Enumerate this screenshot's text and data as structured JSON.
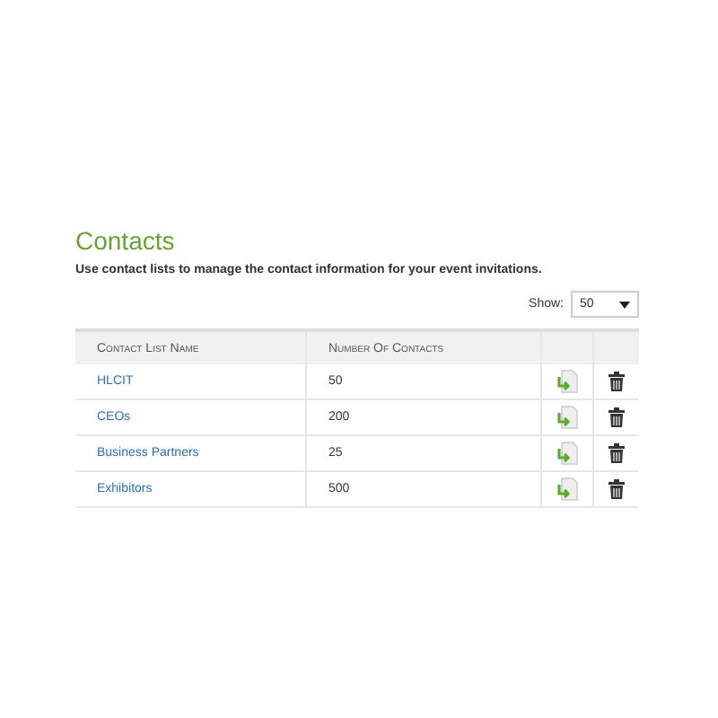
{
  "title": "Contacts",
  "description": "Use contact lists to manage the contact information for your event invitations.",
  "show": {
    "label": "Show:",
    "value": "50"
  },
  "table": {
    "columns": [
      "Contact List Name",
      "Number Of Contacts"
    ],
    "rows": [
      {
        "name": "HLCIT",
        "count": "50"
      },
      {
        "name": "CEOs",
        "count": "200"
      },
      {
        "name": "Business Partners",
        "count": "25"
      },
      {
        "name": "Exhibitors",
        "count": "500"
      }
    ]
  }
}
